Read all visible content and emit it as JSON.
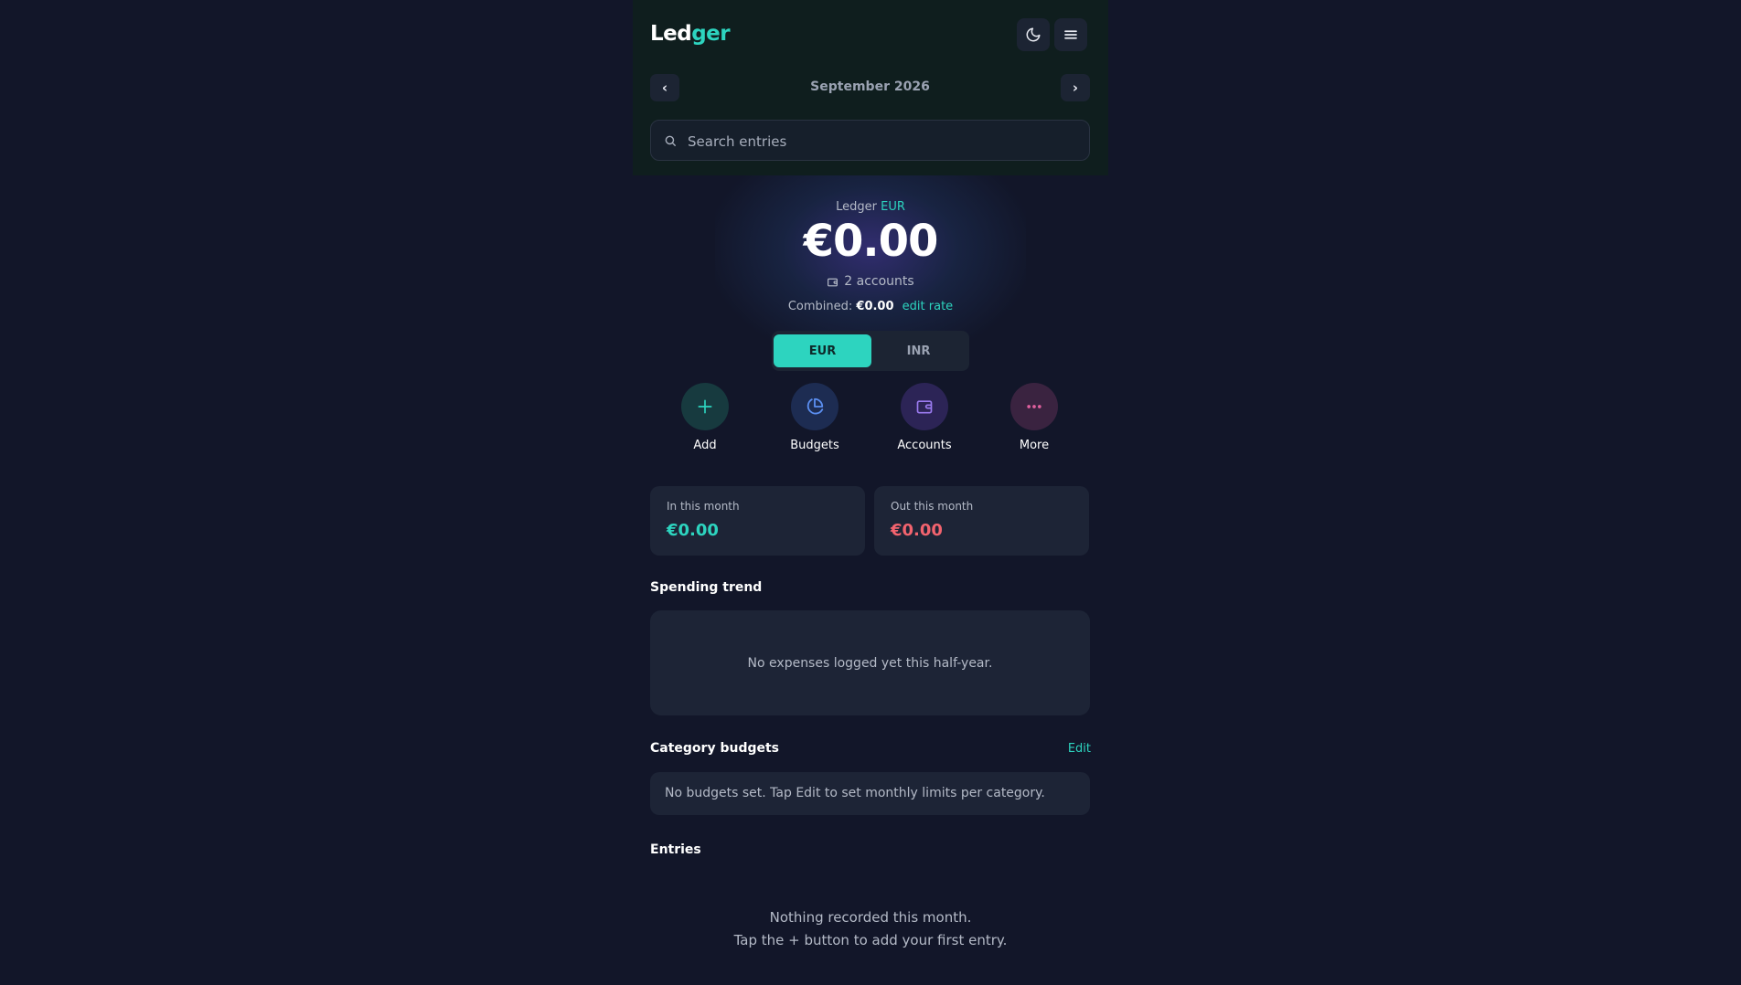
{
  "header": {
    "logo_main": "Led",
    "logo_accent": "ger",
    "theme_icon": "moon-icon",
    "menu_icon": "hamburger-icon"
  },
  "month_nav": {
    "prev": "‹",
    "next": "›",
    "label": "September 2026"
  },
  "search": {
    "placeholder": "Search entries",
    "value": ""
  },
  "summary": {
    "ledger_label": "Ledger",
    "currency": "EUR",
    "balance": "€0.00",
    "accounts": "2 accounts",
    "combined_label": "Combined:",
    "combined_amount": "€0.00",
    "edit_rate": "edit rate"
  },
  "currency_toggle": {
    "options": [
      "EUR",
      "INR"
    ],
    "selected": "EUR"
  },
  "actions": [
    {
      "label": "Add",
      "icon": "plus-icon"
    },
    {
      "label": "Budgets",
      "icon": "pie-chart-icon"
    },
    {
      "label": "Accounts",
      "icon": "wallet-icon"
    },
    {
      "label": "More",
      "icon": "more-dots-icon"
    }
  ],
  "stats": {
    "in_label": "In this month",
    "in_value": "€0.00",
    "out_label": "Out this month",
    "out_value": "€0.00"
  },
  "trend": {
    "title": "Spending trend",
    "empty": "No expenses logged yet this half-year."
  },
  "budgets": {
    "title": "Category budgets",
    "edit": "Edit",
    "empty": "No budgets set. Tap Edit to set monthly limits per category."
  },
  "entries": {
    "title": "Entries",
    "empty_line1": "Nothing recorded this month.",
    "empty_line2": "Tap the + button to add your first entry."
  },
  "colors": {
    "background": "#121629",
    "header_bg": "#0f1e1e",
    "accent": "#2dd4bf",
    "expense": "#f2636e",
    "card": "#1d2436"
  }
}
